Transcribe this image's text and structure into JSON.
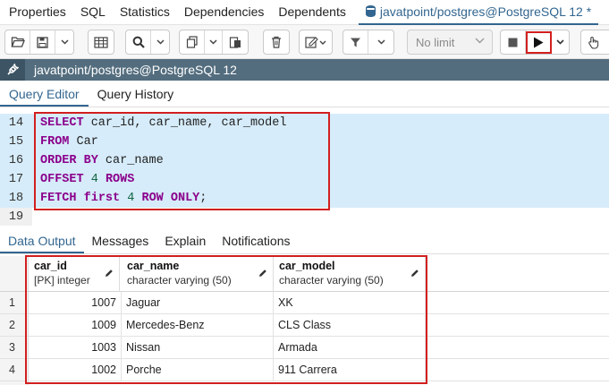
{
  "top_tabs": [
    "Properties",
    "SQL",
    "Statistics",
    "Dependencies",
    "Dependents"
  ],
  "active_tab": {
    "label": "javatpoint/postgres@PostgreSQL 12 *"
  },
  "toolbar": {
    "limit_label": "No limit"
  },
  "connection": {
    "label": "javatpoint/postgres@PostgreSQL 12"
  },
  "editor_tabs": [
    "Query Editor",
    "Query History"
  ],
  "editor": {
    "lines": [
      {
        "num": "14",
        "parts": [
          {
            "t": "SELECT",
            "k": "kw"
          },
          {
            "t": " car_id, car_name, car_model",
            "k": ""
          }
        ]
      },
      {
        "num": "15",
        "parts": [
          {
            "t": "FROM",
            "k": "kw"
          },
          {
            "t": " Car",
            "k": ""
          }
        ]
      },
      {
        "num": "16",
        "parts": [
          {
            "t": "ORDER BY",
            "k": "kw"
          },
          {
            "t": " car_name",
            "k": ""
          }
        ]
      },
      {
        "num": "17",
        "parts": [
          {
            "t": "OFFSET",
            "k": "kw"
          },
          {
            "t": " ",
            "k": ""
          },
          {
            "t": "4",
            "k": "num"
          },
          {
            "t": " ",
            "k": ""
          },
          {
            "t": "ROWS",
            "k": "kw"
          }
        ]
      },
      {
        "num": "18",
        "parts": [
          {
            "t": "FETCH",
            "k": "kw"
          },
          {
            "t": " ",
            "k": ""
          },
          {
            "t": "first",
            "k": "kw"
          },
          {
            "t": " ",
            "k": ""
          },
          {
            "t": "4",
            "k": "num"
          },
          {
            "t": " ",
            "k": ""
          },
          {
            "t": "ROW ONLY",
            "k": "kw"
          },
          {
            "t": ";",
            "k": ""
          }
        ]
      },
      {
        "num": "19",
        "parts": []
      }
    ]
  },
  "output_tabs": [
    "Data Output",
    "Messages",
    "Explain",
    "Notifications"
  ],
  "grid": {
    "columns": [
      {
        "name": "car_id",
        "type": "[PK] integer"
      },
      {
        "name": "car_name",
        "type": "character varying (50)"
      },
      {
        "name": "car_model",
        "type": "character varying (50)"
      }
    ],
    "rows": [
      {
        "num": "1",
        "cells": [
          "1007",
          "Jaguar",
          "XK"
        ]
      },
      {
        "num": "2",
        "cells": [
          "1009",
          "Mercedes-Benz",
          "CLS Class"
        ]
      },
      {
        "num": "3",
        "cells": [
          "1003",
          "Nissan",
          "Armada"
        ]
      },
      {
        "num": "4",
        "cells": [
          "1002",
          "Porche",
          "911 Carrera"
        ]
      }
    ]
  }
}
